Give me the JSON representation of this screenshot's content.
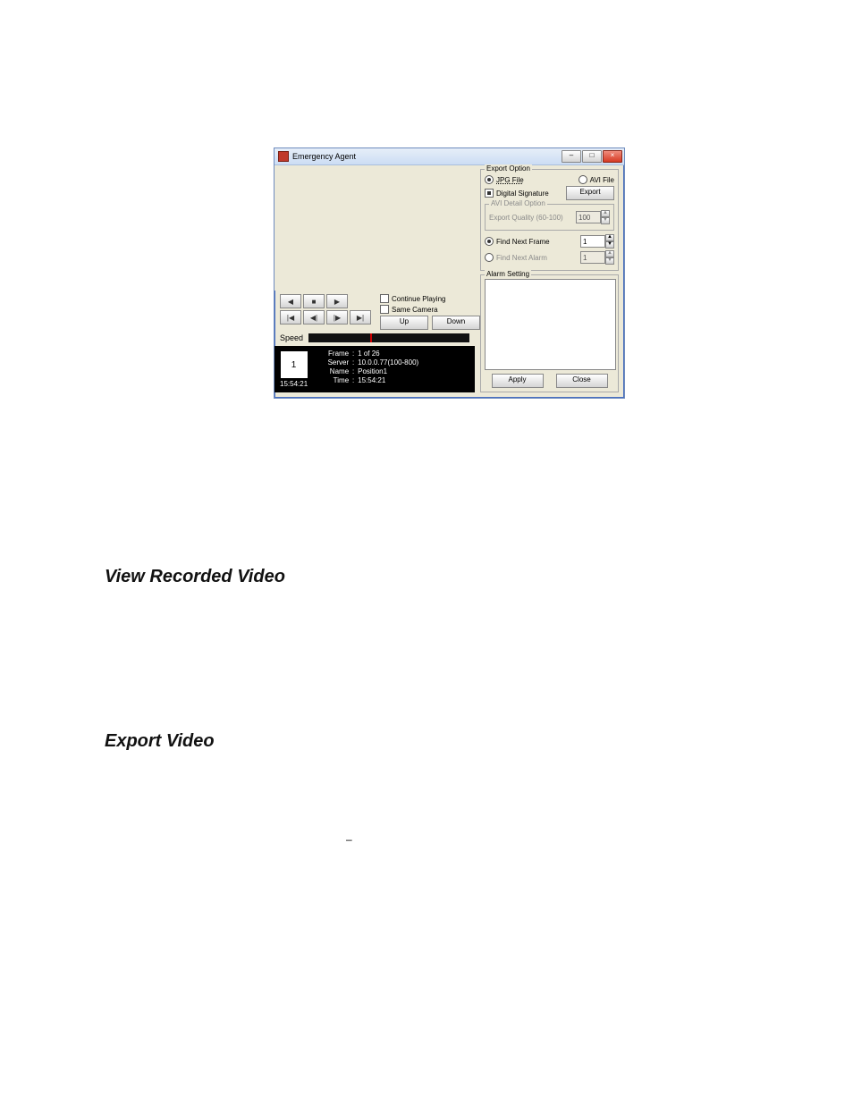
{
  "dialog": {
    "title": "Emergency Agent",
    "window_controls": {
      "minimize": "–",
      "maximize": "□",
      "close": "×"
    },
    "playback_row1": {
      "prev": "◀",
      "stop": "■",
      "play": "▶"
    },
    "playback_row2": {
      "first": "|◀",
      "step_back": "◀|",
      "step_fwd": "|▶",
      "last": "▶|"
    },
    "continue_playing": "Continue Playing",
    "same_camera": "Same Camera",
    "speed_label": "Speed",
    "up_btn": "Up",
    "down_btn": "Down",
    "thumb": {
      "number": "1",
      "time": "15:54:21"
    },
    "info": {
      "frame_k": "Frame",
      "frame_v": "1 of 26",
      "server_k": "Server",
      "server_v": "10.0.0.77(100-800)",
      "name_k": "Name",
      "name_v": "Position1",
      "time_k": "Time",
      "time_v": "15:54:21",
      "colon": ":"
    },
    "export_option": {
      "label": "Export Option",
      "jpg": "JPG File",
      "avi": "AVI File",
      "digital_sig": "Digital Signature",
      "export_btn": "Export"
    },
    "avi_detail": {
      "label": "AVI Detail Option",
      "quality_label": "Export Quality (60-100)",
      "quality_value": "100"
    },
    "find": {
      "next_frame": "Find Next Frame",
      "next_frame_value": "1",
      "next_alarm": "Find Next Alarm",
      "next_alarm_value": "1"
    },
    "alarm_setting": "Alarm Setting",
    "apply": "Apply",
    "close": "Close"
  },
  "headings": {
    "h1": "View Recorded Video",
    "h2": "Export Video"
  },
  "dash": "–"
}
